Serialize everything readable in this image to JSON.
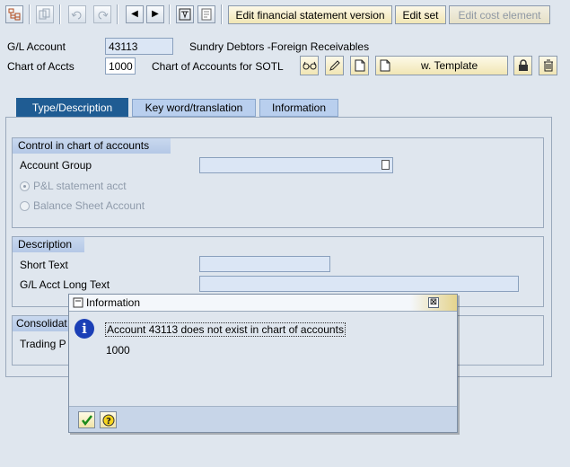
{
  "toolbar": {
    "icons": [
      "tree-icon",
      "copy-icon",
      "undo-icon",
      "redo-icon",
      "left-arrow-icon",
      "right-arrow-icon",
      "select-icon",
      "details-icon"
    ],
    "left_arrow": "◀",
    "right_arrow": "▶",
    "buttons": {
      "edit_fs_version": "Edit financial statement version",
      "edit_set": "Edit set",
      "edit_cost_element": "Edit cost element"
    }
  },
  "header": {
    "gl_account_label": "G/L Account",
    "gl_account_value": "43113",
    "gl_account_desc": "Sundry Debtors -Foreign Receivables",
    "chart_label": "Chart of Accts",
    "chart_value": "1000",
    "chart_desc": "Chart of Accounts for SOTL",
    "template_label": "w. Template"
  },
  "tabs": [
    {
      "label": "Type/Description",
      "active": true
    },
    {
      "label": "Key word/translation",
      "active": false
    },
    {
      "label": "Information",
      "active": false
    }
  ],
  "control_group": {
    "title": "Control in chart of accounts",
    "account_group_label": "Account Group",
    "account_group_value": "",
    "pl_label": "P&L statement acct",
    "bs_label": "Balance Sheet Account"
  },
  "description_group": {
    "title": "Description",
    "short_text_label": "Short Text",
    "short_text_value": "",
    "long_text_label": "G/L Acct Long Text",
    "long_text_value": ""
  },
  "consolidation_group": {
    "title_partial": "Consolidat",
    "trading_partial": "Trading P"
  },
  "dialog": {
    "title": "Information",
    "close_glyph": "⊠",
    "message": "Account 43113 does not exist in chart of accounts",
    "sub": "1000"
  },
  "colors": {
    "active_tab": "#1f5c93",
    "info_icon": "#1b3fb6"
  }
}
